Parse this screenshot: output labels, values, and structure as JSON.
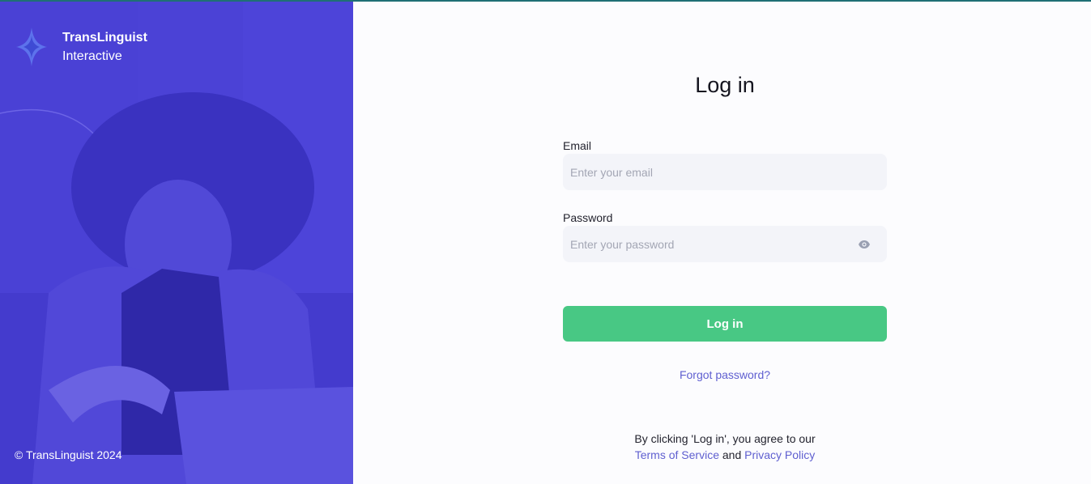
{
  "brand": {
    "name_line1": "TransLinguist",
    "name_line2": "Interactive",
    "copyright": "© TransLinguist 2024"
  },
  "form": {
    "title": "Log in",
    "email_label": "Email",
    "email_placeholder": "Enter your email",
    "email_value": "",
    "password_label": "Password",
    "password_placeholder": "Enter your password",
    "password_value": "",
    "submit_label": "Log in",
    "forgot_label": "Forgot password?"
  },
  "legal": {
    "prefix": "By clicking 'Log in', you agree to our",
    "terms_label": "Terms of Service",
    "joiner": "and",
    "privacy_label": "Privacy Policy"
  },
  "icons": {
    "logo": "sparkle-icon",
    "password_toggle": "eye-icon"
  },
  "colors": {
    "brand_panel": "#4b42d6",
    "primary_button": "#48c884",
    "link": "#5f5fd0",
    "input_bg": "#f3f4f9"
  }
}
